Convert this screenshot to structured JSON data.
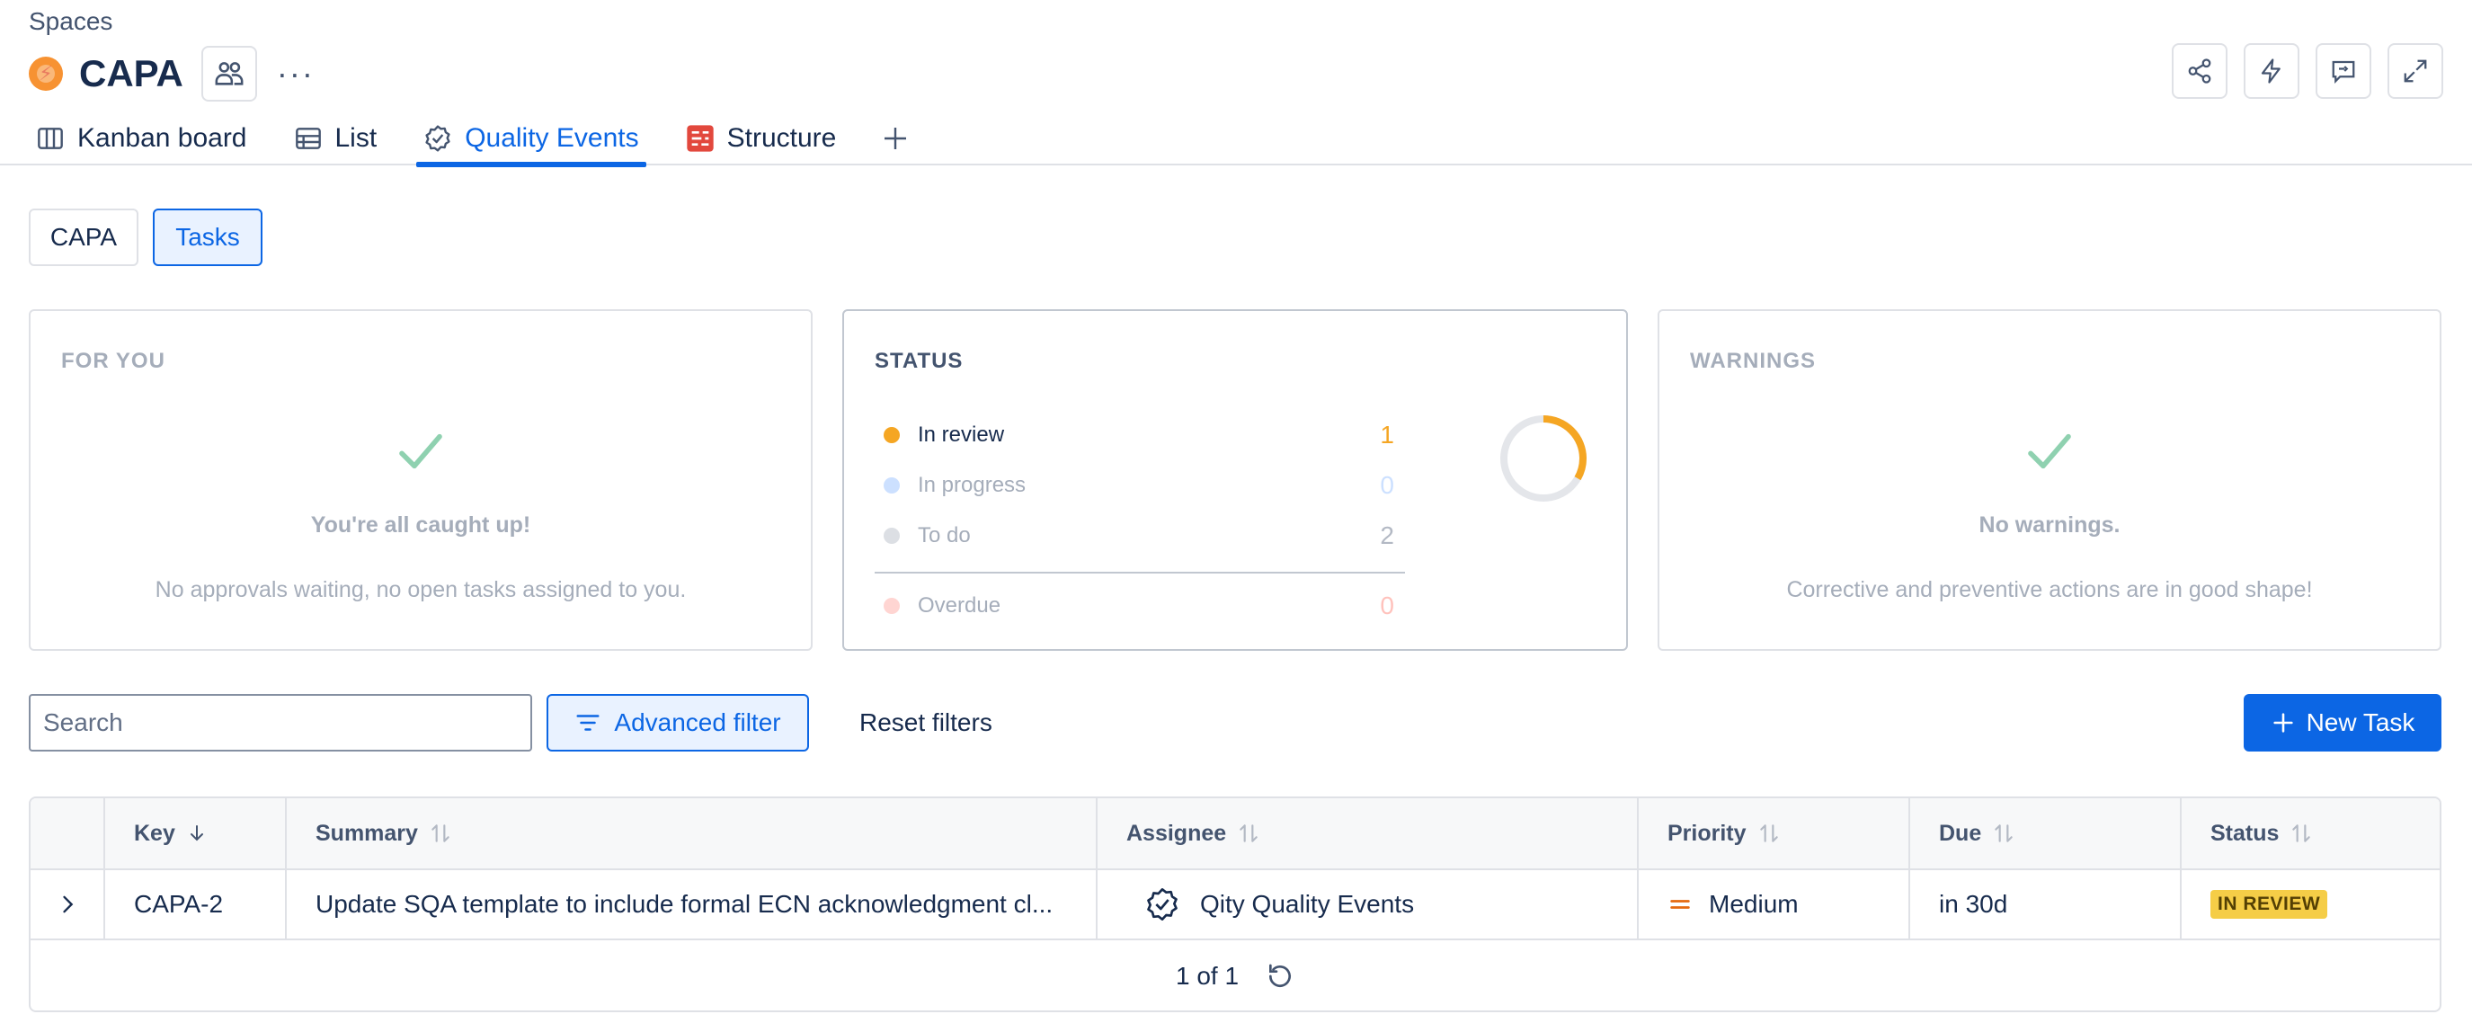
{
  "header": {
    "breadcrumb": "Spaces",
    "title": "CAPA",
    "more_label": "···"
  },
  "tabs": [
    {
      "label": "Kanban board",
      "icon": "board-icon"
    },
    {
      "label": "List",
      "icon": "list-icon"
    },
    {
      "label": "Quality Events",
      "icon": "badge-check-icon",
      "active": true
    },
    {
      "label": "Structure",
      "icon": "structure-icon"
    }
  ],
  "segments": {
    "capa": "CAPA",
    "tasks": "Tasks",
    "selected": "Tasks"
  },
  "cards": {
    "for_you": {
      "title": "FOR YOU",
      "headline": "You're all caught up!",
      "message": "No approvals waiting, no open tasks assigned to you."
    },
    "status": {
      "title": "STATUS",
      "items": [
        {
          "label": "In review",
          "count": "1",
          "color": "#f5a623"
        },
        {
          "label": "In progress",
          "count": "0",
          "color": "#cce0ff"
        },
        {
          "label": "To do",
          "count": "2",
          "color": "#dcdfe4"
        }
      ],
      "overdue": {
        "label": "Overdue",
        "count": "0",
        "color": "#ffd5d2"
      },
      "donut": {
        "total": 3,
        "in_review": 1,
        "in_progress": 0,
        "to_do": 2
      }
    },
    "warnings": {
      "title": "WARNINGS",
      "headline": "No warnings.",
      "message": "Corrective and preventive actions are in good shape!"
    }
  },
  "toolbar": {
    "search_placeholder": "Search",
    "advanced_filter": "Advanced filter",
    "reset_filters": "Reset filters",
    "new_task": "New Task"
  },
  "table": {
    "columns": [
      "Key",
      "Summary",
      "Assignee",
      "Priority",
      "Due",
      "Status"
    ],
    "rows": [
      {
        "key": "CAPA-2",
        "summary": "Update SQA template to include formal ECN acknowledgment cl...",
        "assignee": "Qity Quality Events",
        "priority": "Medium",
        "due": "in 30d",
        "status": "IN REVIEW"
      }
    ],
    "pagination": "1 of 1"
  },
  "colors": {
    "accent": "#0c66e4",
    "success": "#57d9a3",
    "in_review": "#f5a623",
    "badge": "#f5cd47"
  }
}
